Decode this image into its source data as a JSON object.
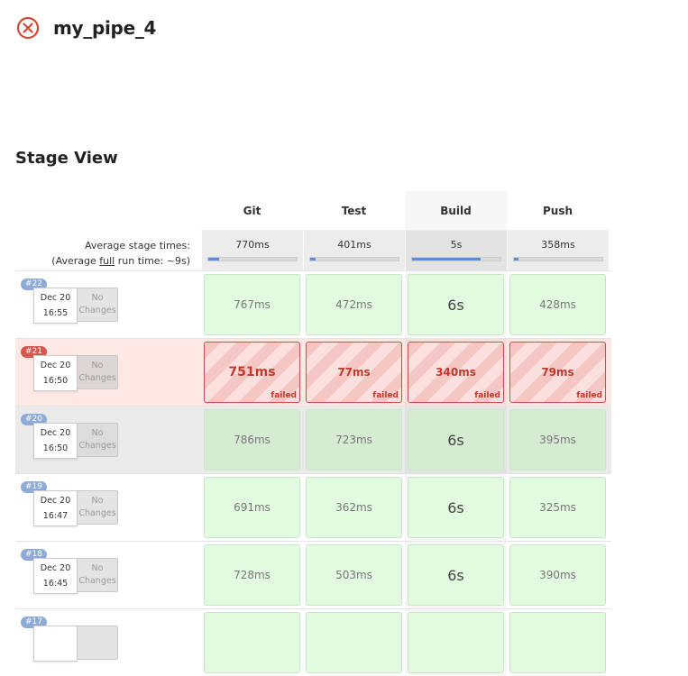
{
  "job": {
    "title": "my_pipe_4",
    "status_icon": "failed-circle-x-icon",
    "status_color": "#d24939"
  },
  "section_title": "Stage View",
  "stages": [
    {
      "name": "Git",
      "avg": "770ms",
      "avg_fraction": 0.12
    },
    {
      "name": "Test",
      "avg": "401ms",
      "avg_fraction": 0.06
    },
    {
      "name": "Build",
      "avg": "5s",
      "avg_fraction": 0.78
    },
    {
      "name": "Push",
      "avg": "358ms",
      "avg_fraction": 0.05
    }
  ],
  "avg_label_line1": "Average stage times:",
  "avg_label_line2_prefix": "(Average ",
  "avg_label_line2_link": "full",
  "avg_label_line2_suffix": " run time: ~9s)",
  "failed_label": "failed",
  "builds": [
    {
      "number": "#22",
      "date": "Dec 20",
      "time": "16:55",
      "changes": "No Changes",
      "status": "success",
      "stages": [
        "767ms",
        "472ms",
        "6s",
        "428ms"
      ]
    },
    {
      "number": "#21",
      "date": "Dec 20",
      "time": "16:50",
      "changes": "No Changes",
      "status": "failed",
      "stages": [
        "751ms",
        "77ms",
        "340ms",
        "79ms"
      ]
    },
    {
      "number": "#20",
      "date": "Dec 20",
      "time": "16:50",
      "changes": "No Changes",
      "status": "success-gray",
      "stages": [
        "786ms",
        "723ms",
        "6s",
        "395ms"
      ]
    },
    {
      "number": "#19",
      "date": "Dec 20",
      "time": "16:47",
      "changes": "No Changes",
      "status": "success",
      "stages": [
        "691ms",
        "362ms",
        "6s",
        "325ms"
      ]
    },
    {
      "number": "#18",
      "date": "Dec 20",
      "time": "16:45",
      "changes": "No Changes",
      "status": "success",
      "stages": [
        "728ms",
        "503ms",
        "6s",
        "390ms"
      ]
    },
    {
      "number": "#17",
      "date": "",
      "time": "",
      "changes": "",
      "status": "success",
      "stages": [
        "",
        "",
        "",
        ""
      ]
    }
  ]
}
